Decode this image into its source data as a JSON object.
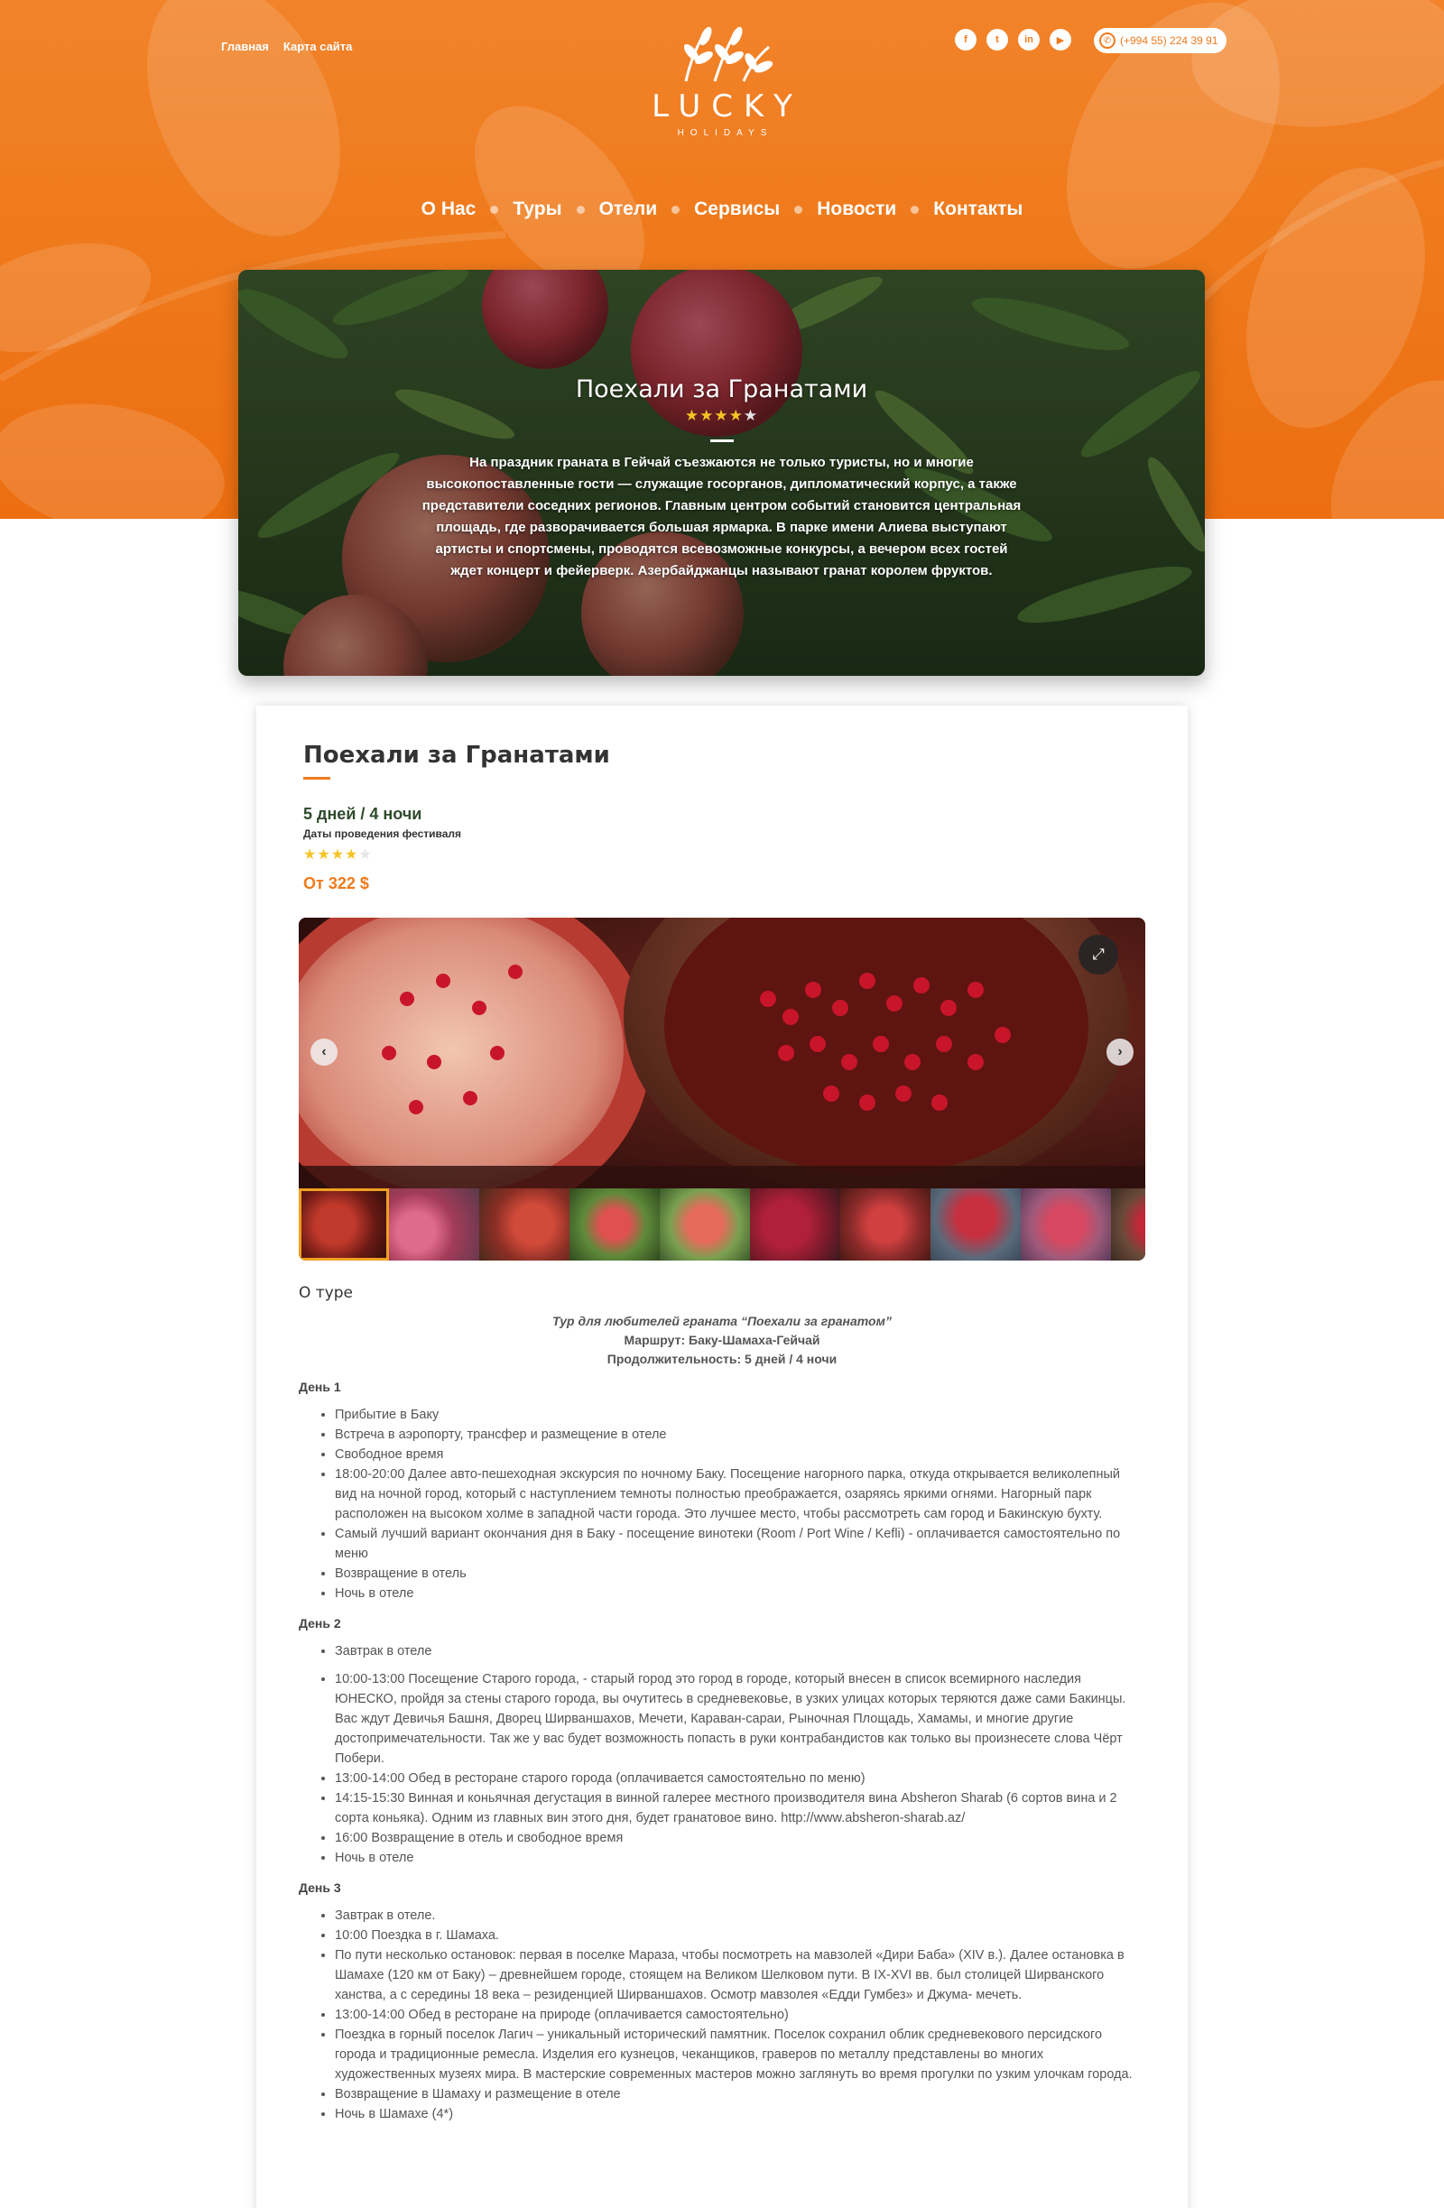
{
  "top_links": {
    "home": "Главная",
    "sitemap": "Карта сайта"
  },
  "logo": {
    "name": "LUCKY",
    "tagline": "HOLIDAYS"
  },
  "socials": {
    "facebook": "f",
    "twitter": "t",
    "linkedin": "in",
    "youtube": "▶"
  },
  "phone": "(+994 55) 224 39 91",
  "nav": [
    "О Нас",
    "Туры",
    "Отели",
    "Сервисы",
    "Новости",
    "Контакты"
  ],
  "hero": {
    "title": "Поехали за Гранатами",
    "rating": 4,
    "rating_text": "★★★★",
    "rating_rest": "★",
    "description": "На праздник граната в Гейчай съезжаются не только туристы, но и многие высокопоставленные гости — служащие госорганов, дипломатический корпус, а также представители соседних регионов. Главным центром событий становится центральная площадь, где разворачивается большая ярмарка. В парке имени Алиева выступают артисты и спортсмены, проводятся всевозможные конкурсы, а вечером всех гостей ждет концерт и фейерверк. Азербайджанцы называют гранат королем фруктов."
  },
  "tour": {
    "title": "Поехали за Гранатами",
    "duration": "5 дней / 4 ночи",
    "dates_label": "Даты проведения фестиваля",
    "rating": 4,
    "rating_text": "★★★★",
    "rating_rest": "★",
    "price": "От 322 $"
  },
  "gallery": {
    "expand": "⤢",
    "prev": "‹",
    "next": "›",
    "thumb_count": 10,
    "active_thumb": 1
  },
  "about": {
    "heading": "О туре",
    "subtitle": "Тур для любителей граната “Поехали за гранатом”",
    "route": "Маршрут: Баку-Шамаха-Гейчай",
    "length": "Продолжительность: 5 дней / 4 ночи"
  },
  "days": [
    {
      "label": "День 1",
      "items": [
        "Прибытие в Баку",
        "Встреча в аэропорту, трансфер и размещение в отеле",
        "Свободное время",
        "18:00-20:00 Далее авто-пешеходная экскурсия по ночному Баку. Посещение нагорного парка, откуда открывается великолепный вид на ночной город, который с наступлением темноты полностью преображается, озаряясь яркими огнями. Нагорный парк расположен на высоком холме в западной части города. Это лучшее место, чтобы рассмотреть сам город и Бакинскую бухту.",
        "Самый лучший вариант окончания дня в Баку - посещение винотеки (Room / Port Wine / Kefli) - оплачивается самостоятельно по меню",
        "Возвращение в отель",
        "Ночь в отеле"
      ]
    },
    {
      "label": "День 2",
      "items": [
        "Завтрак в отеле",
        "10:00-13:00 Посещение Старого города, - старый город это город в городе, который внесен в список всемирного наследия ЮНЕСКО, пройдя за стены старого города, вы очутитесь в средневековье, в узких улицах которых теряются даже сами Бакинцы. Вас ждут Девичья Башня, Дворец Ширваншахов, Мечети, Караван-сараи, Рыночная Площадь, Хамамы, и многие другие достопримечательности. Так же у вас будет возможность попасть в руки контрабандистов как только вы произнесете слова Чёрт Побери.",
        "13:00-14:00 Обед в ресторане старого города (оплачивается самостоятельно по меню)",
        "14:15-15:30 Винная и коньячная дегустация в винной галерее местного производителя вина Absheron Sharab (6 сортов вина и 2 сорта коньяка). Одним из главных вин этого дня, будет гранатовое вино. http://www.absheron-sharab.az/",
        "16:00 Возвращение в отель и свободное время",
        "Ночь в отеле"
      ]
    },
    {
      "label": "День 3",
      "items": [
        "Завтрак в отеле.",
        "10:00 Поездка в г. Шамаха.",
        "По пути несколько остановок: первая в поселке Мараза, чтобы посмотреть на мавзолей «Дири Баба» (XIV в.). Далее остановка в Шамахе (120 км от Баку) – древнейшем городе, стоящем на Великом Шелковом пути. В IX-XVI вв. был столицей Ширванского ханства, а с середины 18 века – резиденцией Ширваншахов. Осмотр мавзолея «Едди Гумбез» и Джума- мечеть.",
        "13:00-14:00 Обед в ресторане на природе (оплачивается самостоятельно)",
        "Поездка в горный поселок Лагич – уникальный исторический памятник. Поселок сохранил облик средневекового персидского города и традиционные ремесла. Изделия его кузнецов, чеканщиков, граверов по металлу представлены во многих художественных музеях мира. В мастерские современных мастеров можно заглянуть во время прогулки по узким улочкам города.",
        "Возвращение в Шамаху и размещение в отеле",
        "Ночь в Шамахе (4*)"
      ]
    }
  ],
  "colors": {
    "brand_orange": "#ef7a1c",
    "star": "#f6c324",
    "dark_green": "#2f4a2c"
  }
}
